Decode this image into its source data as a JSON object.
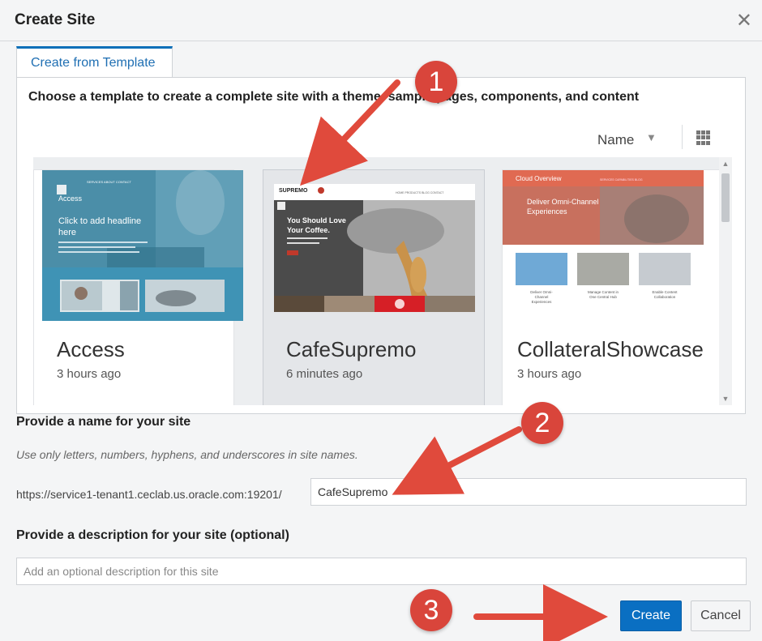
{
  "dialog": {
    "title": "Create Site",
    "close_glyph": "✕"
  },
  "tabs": [
    {
      "label": "Create from Template",
      "active": true
    }
  ],
  "template_panel": {
    "instruction": "Choose a template to create a complete site with a theme, sample pages, components, and content",
    "sort_label": "Name",
    "sort_icon": "chevron-down-icon",
    "view_icon": "grid-view-icon"
  },
  "templates": [
    {
      "name": "Access",
      "time": "3 hours ago",
      "selected": false,
      "thumb": {
        "nav": [
          "SERVICES",
          "ABOUT",
          "CONTACT",
          "GET IN TOUCH"
        ],
        "title": "Access",
        "headline": "Click to add headline here"
      }
    },
    {
      "name": "CafeSupremo",
      "time": "6 minutes ago",
      "selected": true,
      "thumb": {
        "logo": "SUPREMO",
        "nav": [
          "HOME",
          "PRODUCTS",
          "BLOG",
          "CONTACT"
        ],
        "headline": "You Should Love Your Coffee."
      }
    },
    {
      "name": "CollateralShowcase",
      "time": "3 hours ago",
      "selected": false,
      "thumb": {
        "logo": "Cloud Overview",
        "headline": "Deliver Omni-Channel Experiences",
        "tiles": [
          "Deliver Omni-Channel Experiences",
          "Manage Content in One Central Hub",
          "Enable Content Collaboration"
        ]
      }
    }
  ],
  "name_section": {
    "label": "Provide a name for your site",
    "hint": "Use only letters, numbers, hyphens, and underscores in site names.",
    "url_prefix": "https://service1-tenant1.ceclab.us.oracle.com:19201/",
    "value": "CafeSupremo"
  },
  "description_section": {
    "label": "Provide a description for your site (optional)",
    "placeholder": "Add an optional description for this site",
    "value": ""
  },
  "buttons": {
    "create": "Create",
    "cancel": "Cancel"
  },
  "callouts": [
    "1",
    "2",
    "3"
  ],
  "colors": {
    "accent": "#0a6fc2",
    "callout": "#d9453b",
    "tab_active": "#1f6fb3"
  }
}
